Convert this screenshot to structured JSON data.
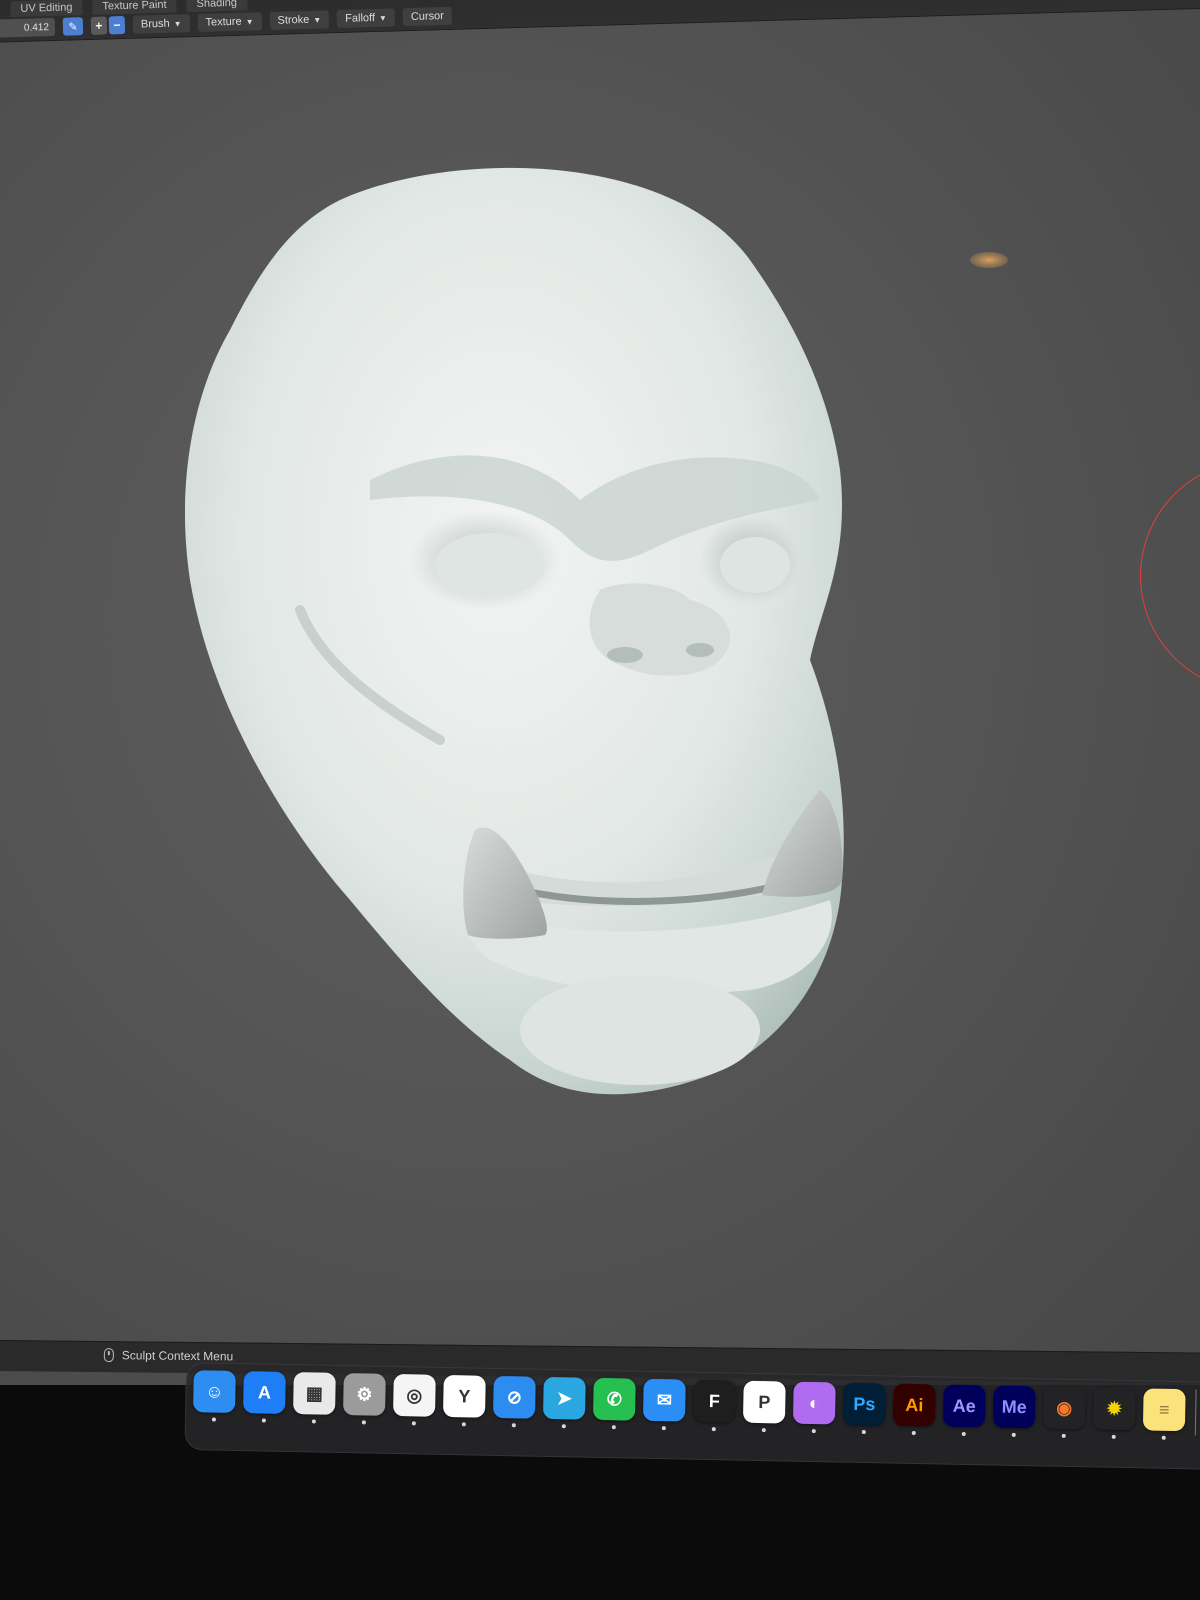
{
  "workspace_tabs": [
    {
      "label": "UV Editing"
    },
    {
      "label": "Texture Paint"
    },
    {
      "label": "Shading"
    }
  ],
  "header": {
    "strength_value": "0.412",
    "menus": [
      {
        "label": "Brush"
      },
      {
        "label": "Texture"
      },
      {
        "label": "Stroke"
      },
      {
        "label": "Falloff"
      },
      {
        "label": "Cursor"
      }
    ]
  },
  "status_bar": {
    "hint": "Sculpt Context Menu"
  },
  "dock": {
    "apps": [
      {
        "name": "finder-icon",
        "color": "#2e8df0",
        "glyph": "☺"
      },
      {
        "name": "app-store-icon",
        "color": "#1e7ef5",
        "glyph": "A"
      },
      {
        "name": "launchpad-icon",
        "color": "#e9e9e9",
        "glyph": "▦"
      },
      {
        "name": "system-settings-icon",
        "color": "#9b9b9b",
        "glyph": "⚙"
      },
      {
        "name": "chrome-icon",
        "color": "#f5f5f5",
        "glyph": "◎"
      },
      {
        "name": "yandex-browser-icon",
        "color": "#ffffff",
        "glyph": "Y"
      },
      {
        "name": "safari-icon",
        "color": "#2d8cf0",
        "glyph": "⊘"
      },
      {
        "name": "telegram-icon",
        "color": "#2aa6e0",
        "glyph": "➤"
      },
      {
        "name": "whatsapp-icon",
        "color": "#25c04f",
        "glyph": "✆"
      },
      {
        "name": "mail-icon",
        "color": "#2b8ef5",
        "glyph": "✉"
      },
      {
        "name": "figma-icon",
        "color": "#1e1e1e",
        "glyph": "F"
      },
      {
        "name": "pixso-icon",
        "color": "#ffffff",
        "glyph": "P"
      },
      {
        "name": "color-ui-icon",
        "color": "#b06cf0",
        "glyph": "◐"
      },
      {
        "name": "photoshop-icon",
        "color": "#001e36",
        "glyph": "Ps",
        "text_color": "#31a8ff"
      },
      {
        "name": "illustrator-icon",
        "color": "#330000",
        "glyph": "Ai",
        "text_color": "#ff9a00"
      },
      {
        "name": "after-effects-icon",
        "color": "#00005b",
        "glyph": "Ae",
        "text_color": "#9999ff"
      },
      {
        "name": "media-encoder-icon",
        "color": "#00005b",
        "glyph": "Me",
        "text_color": "#8f8fff"
      },
      {
        "name": "blender-icon",
        "color": "transparent",
        "glyph": "◉",
        "text_color": "#f5792a"
      },
      {
        "name": "sparkle-app-icon",
        "color": "transparent",
        "glyph": "✹",
        "text_color": "#f4d400"
      },
      {
        "name": "notes-icon",
        "color": "#fbe27a",
        "glyph": "≡",
        "text_color": "#8a7a3a"
      }
    ]
  },
  "colors": {
    "viewport_bg": "#555555",
    "header_bg": "#2b2b2b",
    "accent_blue": "#4c7fd1",
    "brush_cursor": "#e04040",
    "model_clay": "#dfe6e2"
  }
}
